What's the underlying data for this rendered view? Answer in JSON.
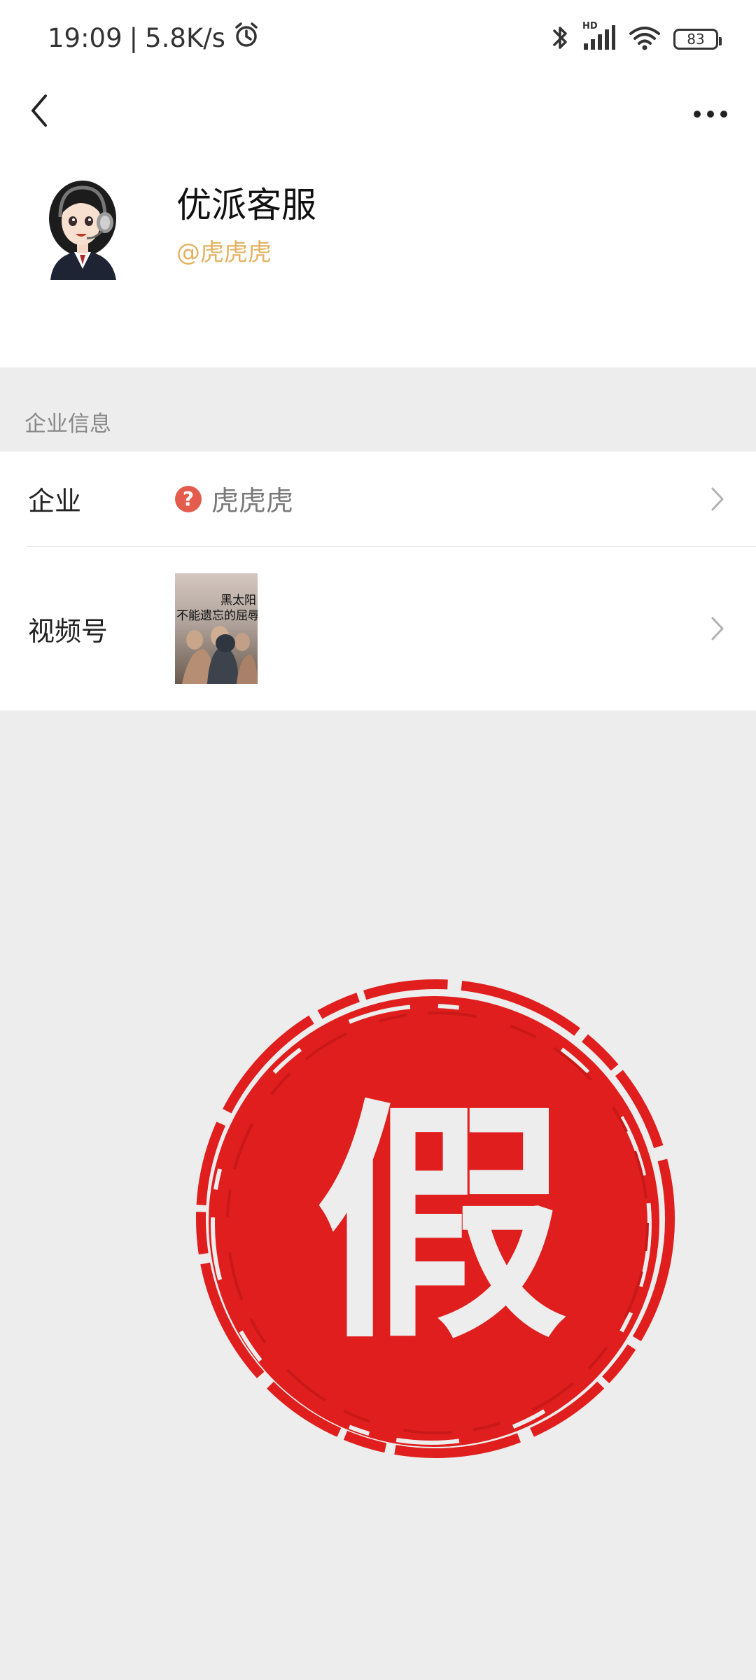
{
  "status_bar": {
    "time": "19:09",
    "separator": "|",
    "speed": "5.8K/s",
    "battery": "83",
    "network_badge": "HD"
  },
  "header": {
    "back_icon": "chevron-left-icon",
    "more_icon": "more-horizontal-icon",
    "name": "优派客服",
    "handle": "@虎虎虎"
  },
  "section": {
    "title": "企业信息"
  },
  "rows": [
    {
      "label": "企业",
      "value": "虎虎虎",
      "icon": "question-icon",
      "icon_glyph": "?"
    },
    {
      "label": "视频号",
      "thumb_lines": [
        "黑太阳",
        "不能遗忘的屈辱"
      ]
    }
  ],
  "stamp": {
    "text": "假",
    "color": "#e01e1e"
  }
}
